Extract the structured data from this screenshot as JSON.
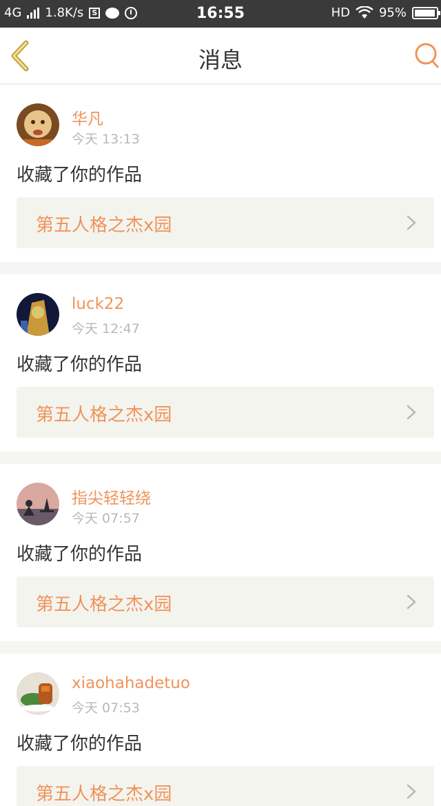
{
  "status_bar": {
    "network": "4G",
    "speed": "1.8K/s",
    "sim_letter": "S",
    "time": "16:55",
    "hd": "HD",
    "battery": "95%",
    "battery_level": 0.95
  },
  "header": {
    "title": "消息",
    "back_icon": "chevron-left-icon",
    "search_icon": "search-icon"
  },
  "colors": {
    "accent": "#f0935a",
    "back_arrow": "#c8a23a",
    "card_link_bg": "#f4f4ef"
  },
  "messages": [
    {
      "username": "华凡",
      "time": "今天 13:13",
      "action": "收藏了你的作品",
      "work_title": "第五人格之杰x园"
    },
    {
      "username": "luck22",
      "time": "今天 12:47",
      "action": "收藏了你的作品",
      "work_title": "第五人格之杰x园"
    },
    {
      "username": "指尖轻轻绕",
      "time": "今天 07:57",
      "action": "收藏了你的作品",
      "work_title": "第五人格之杰x园"
    },
    {
      "username": "xiaohahadetuo",
      "time": "今天 07:53",
      "action": "收藏了你的作品",
      "work_title": "第五人格之杰x园"
    }
  ]
}
